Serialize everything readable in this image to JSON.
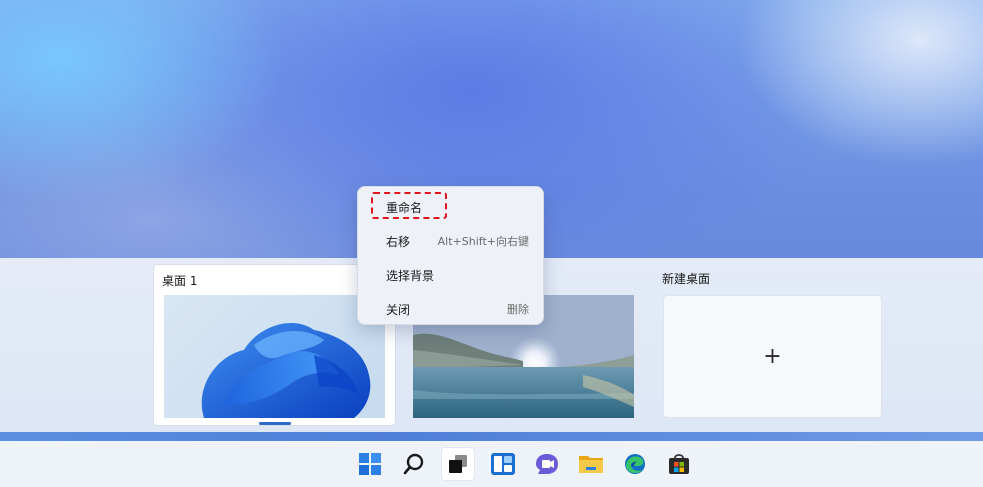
{
  "task_view": {
    "desktops": [
      {
        "title": "桌面 1",
        "active": true
      },
      {
        "title": "",
        "active": false
      }
    ],
    "new_desktop": {
      "title": "新建桌面",
      "plus": "+"
    }
  },
  "context_menu": {
    "items": [
      {
        "label": "重命名",
        "shortcut": "",
        "highlighted": true
      },
      {
        "label": "右移",
        "shortcut": "Alt+Shift+向右键"
      },
      {
        "label": "选择背景",
        "shortcut": ""
      },
      {
        "label": "关闭",
        "shortcut": "删除"
      }
    ],
    "highlight_color": "#e0151c"
  },
  "taskbar": {
    "icons": [
      "start-icon",
      "search-icon",
      "task-view-icon",
      "widgets-icon",
      "teams-chat-icon",
      "file-explorer-icon",
      "edge-icon",
      "store-icon"
    ],
    "active_icon": "task-view-icon",
    "accent": "#2d6ac9"
  }
}
